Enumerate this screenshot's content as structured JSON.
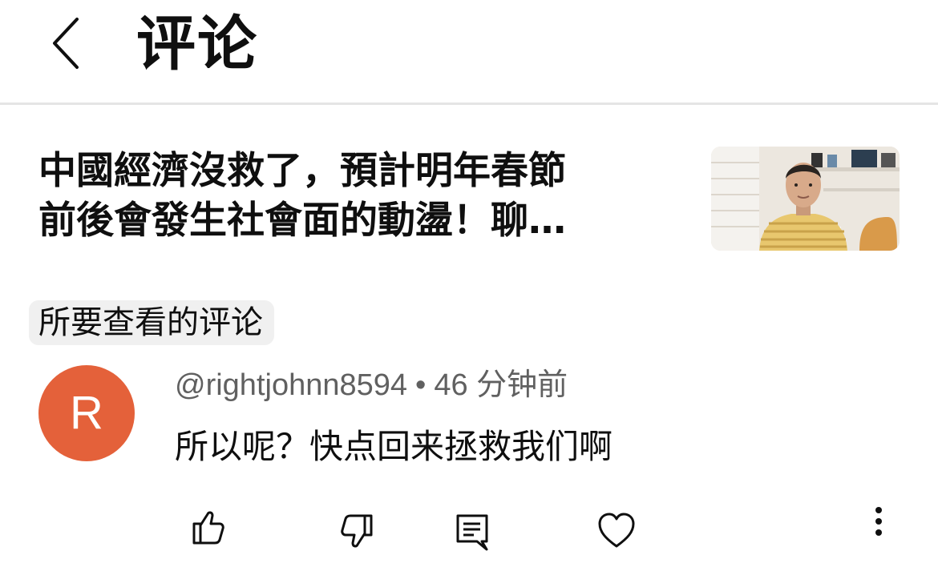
{
  "header": {
    "back_icon": "chevron-left-icon",
    "title": "评论"
  },
  "video": {
    "title_line1": "中國經濟沒救了，預計明年春節",
    "title_line2": "前後會發生社會面的動盪！聊…"
  },
  "filter_chip": {
    "label": "所要查看的评论"
  },
  "comment": {
    "avatar_letter": "R",
    "avatar_color": "#e4613a",
    "author": "@rightjohnn8594",
    "separator": "•",
    "time": "46 分钟前",
    "text": "所以呢？快点回来拯救我们啊"
  },
  "actions": {
    "icons": [
      "thumbs-up-icon",
      "thumbs-down-icon",
      "reply-icon",
      "heart-icon",
      "more-vertical-icon"
    ]
  }
}
